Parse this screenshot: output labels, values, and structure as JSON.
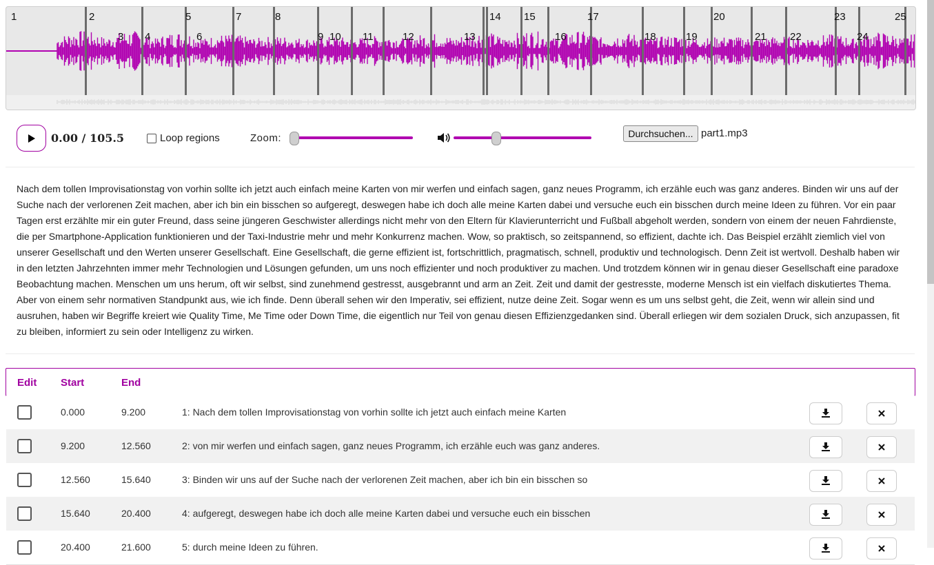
{
  "waveform": {
    "regions": [
      "1",
      "2",
      "3",
      "4",
      "5",
      "6",
      "7",
      "8",
      "9",
      "10",
      "11",
      "12",
      "13",
      "14",
      "15",
      "16",
      "17",
      "18",
      "19",
      "20",
      "21",
      "22",
      "23",
      "24",
      "25"
    ],
    "wave_color": "#b000b0"
  },
  "player": {
    "play_icon": "play-icon",
    "time": "0.00 / 105.5",
    "loop_label": "Loop regions",
    "loop_checked": false,
    "zoom_label": "Zoom:",
    "zoom_level": 0.0,
    "volume_icon": "volume-icon",
    "volume_level": 0.35,
    "file_button": "Durchsuchen...",
    "file_name": "part1.mp3"
  },
  "transcript": "Nach dem tollen Improvisationstag von vorhin sollte ich jetzt auch einfach meine Karten von mir werfen und einfach sagen, ganz neues Programm, ich erzähle euch was ganz anderes. Binden wir uns auf der Suche nach der verlorenen Zeit machen, aber ich bin ein bisschen so aufgeregt, deswegen habe ich doch alle meine Karten dabei und versuche euch ein bisschen durch meine Ideen zu führen. Vor ein paar Tagen erst erzählte mir ein guter Freund, dass seine jüngeren Geschwister allerdings nicht mehr von den Eltern für Klavierunterricht und Fußball abgeholt werden, sondern von einem der neuen Fahrdienste, die per Smartphone-Application funktionieren und der Taxi-Industrie mehr und mehr Konkurrenz machen. Wow, so praktisch, so zeitspannend, so effizient, dachte ich. Das Beispiel erzählt ziemlich viel von unserer Gesellschaft und den Werten unserer Gesellschaft. Eine Gesellschaft, die gerne effizient ist, fortschrittlich, pragmatisch, schnell, produktiv und technologisch. Denn Zeit ist wertvoll. Deshalb haben wir in den letzten Jahrzehnten immer mehr Technologien und Lösungen gefunden, um uns noch effizienter und noch produktiver zu machen. Und trotzdem können wir in genau dieser Gesellschaft eine paradoxe Beobachtung machen. Menschen um uns herum, oft wir selbst, sind zunehmend gestresst, ausgebrannt und arm an Zeit. Zeit und damit der gestresste, moderne Mensch ist ein vielfach diskutiertes Thema. Aber von einem sehr normativen Standpunkt aus, wie ich finde. Denn überall sehen wir den Imperativ, sei effizient, nutze deine Zeit. Sogar wenn es um uns selbst geht, die Zeit, wenn wir allein sind und ausruhen, haben wir Begriffe kreiert wie Quality Time, Me Time oder Down Time, die eigentlich nur Teil von genau diesen Effizienzgedanken sind. Überall erliegen wir dem sozialen Druck, sich anzupassen, fit zu bleiben, informiert zu sein oder Intelligenz zu wirken.",
  "table": {
    "headers": {
      "edit": "Edit",
      "start": "Start",
      "end": "End"
    },
    "rows": [
      {
        "start": "0.000",
        "end": "9.200",
        "text": "1: Nach dem tollen Improvisationstag von vorhin sollte ich jetzt auch einfach meine Karten"
      },
      {
        "start": "9.200",
        "end": "12.560",
        "text": "2: von mir werfen und einfach sagen, ganz neues Programm, ich erzähle euch was ganz anderes."
      },
      {
        "start": "12.560",
        "end": "15.640",
        "text": "3: Binden wir uns auf der Suche nach der verlorenen Zeit machen, aber ich bin ein bisschen so"
      },
      {
        "start": "15.640",
        "end": "20.400",
        "text": "4: aufgeregt, deswegen habe ich doch alle meine Karten dabei und versuche euch ein bisschen"
      },
      {
        "start": "20.400",
        "end": "21.600",
        "text": "5: durch meine Ideen zu führen."
      }
    ],
    "download_icon": "download-icon",
    "delete_icon": "close-icon",
    "accent": "#a000a0"
  }
}
